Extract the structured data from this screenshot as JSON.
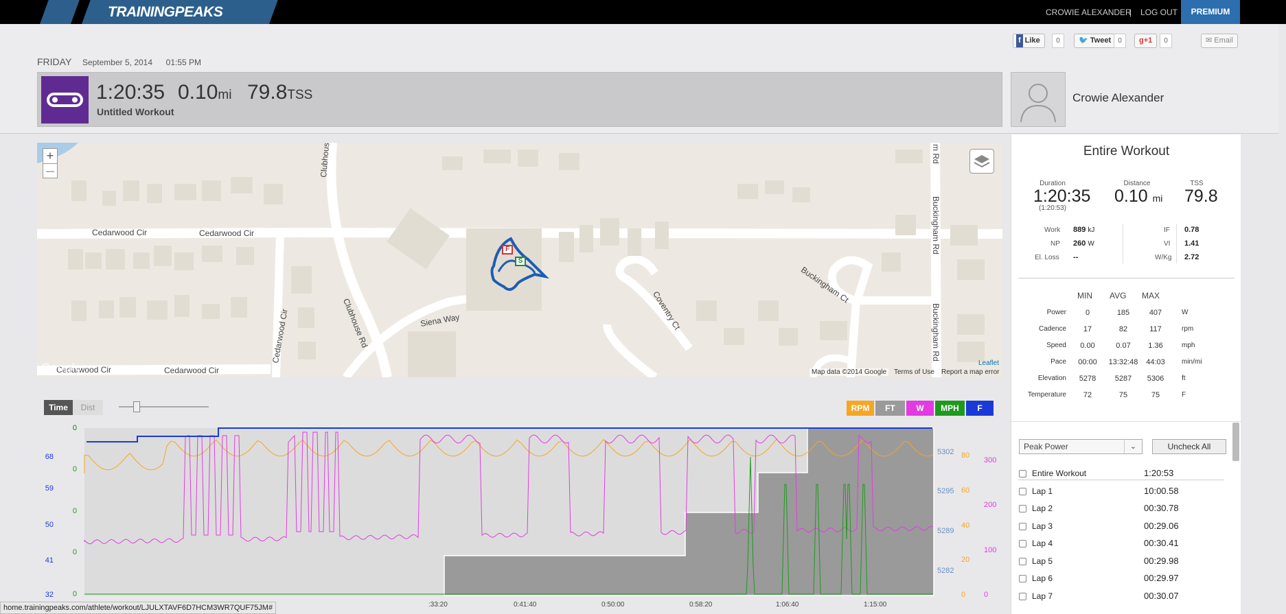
{
  "nav": {
    "brand": "TRAININGPEAKS",
    "user": "CROWIE ALEXANDER",
    "sep": "|",
    "logout": "LOG OUT",
    "premium": "PREMIUM"
  },
  "social": {
    "like": "Like",
    "like_count": "0",
    "tweet": "Tweet",
    "tweet_count": "0",
    "gplus": "+1",
    "gplus_count": "0",
    "email": "Email"
  },
  "workout": {
    "day": "FRIDAY",
    "date": "September 5, 2014",
    "time": "01:55 PM",
    "duration": "1:20:35",
    "distance": "0.10",
    "distance_unit": "mi",
    "tss": "79.8",
    "tss_unit": "TSS",
    "title": "Untitled Workout"
  },
  "athlete": {
    "name": "Crowie Alexander"
  },
  "map": {
    "zoom_in": "+",
    "zoom_out": "—",
    "leaflet": "Leaflet",
    "mapdata": "Map data ©2014 Google",
    "terms": "Terms of Use",
    "report": "Report a map error",
    "google": "Google",
    "roads": [
      "Cedarwood Cir",
      "Cedarwood Cir",
      "Clubhouse",
      "Clubhouse Rd",
      "Siena Way",
      "Cedarwood Cir",
      "Cedarwood Cir",
      "Cedarwood Cir",
      "Coventry Ct",
      "Buckingham Ct",
      "Buckingham Rd",
      "Buckingham Rd",
      "m Rd"
    ],
    "marker_finish": "F",
    "marker_start": "S"
  },
  "summary": {
    "title": "Entire Workout",
    "duration_label": "Duration",
    "duration": "1:20:35",
    "duration_sub": "(1:20:53)",
    "distance_label": "Distance",
    "distance": "0.10",
    "distance_unit": "mi",
    "tss_label": "TSS",
    "tss": "79.8",
    "work_label": "Work",
    "work": "889",
    "work_unit": "kJ",
    "np_label": "NP",
    "np": "260",
    "np_unit": "W",
    "elloss_label": "El. Loss",
    "elloss": "--",
    "if_label": "IF",
    "if": "0.78",
    "vi_label": "VI",
    "vi": "1.41",
    "wkg_label": "W/Kg",
    "wkg": "2.72",
    "headers": [
      "MIN",
      "AVG",
      "MAX"
    ],
    "rows": [
      {
        "label": "Power",
        "min": "0",
        "avg": "185",
        "max": "407",
        "unit": "W"
      },
      {
        "label": "Cadence",
        "min": "17",
        "avg": "82",
        "max": "117",
        "unit": "rpm"
      },
      {
        "label": "Speed",
        "min": "0.00",
        "avg": "0.07",
        "max": "1.36",
        "unit": "mph"
      },
      {
        "label": "Pace",
        "min": "00:00",
        "avg": "13:32:48",
        "max": "44:03",
        "unit": "min/mi"
      },
      {
        "label": "Elevation",
        "min": "5278",
        "avg": "5287",
        "max": "5306",
        "unit": "ft"
      },
      {
        "label": "Temperature",
        "min": "72",
        "avg": "75",
        "max": "75",
        "unit": "F"
      }
    ]
  },
  "laps": {
    "dropdown": "Peak Power",
    "uncheck": "Uncheck All",
    "items": [
      {
        "label": "Entire Workout",
        "time": "1:20:53"
      },
      {
        "label": "Lap 1",
        "time": "10:00.58"
      },
      {
        "label": "Lap 2",
        "time": "00:30.78"
      },
      {
        "label": "Lap 3",
        "time": "00:29.06"
      },
      {
        "label": "Lap 4",
        "time": "00:30.41"
      },
      {
        "label": "Lap 5",
        "time": "00:29.98"
      },
      {
        "label": "Lap 6",
        "time": "00:29.97"
      },
      {
        "label": "Lap 7",
        "time": "00:30.07"
      }
    ]
  },
  "graph": {
    "time_toggle": "Time",
    "dist_toggle": "Dist",
    "chips": [
      {
        "label": "RPM",
        "color": "#f5a623"
      },
      {
        "label": "FT",
        "color": "#9a9a9a"
      },
      {
        "label": "W",
        "color": "#e23be2"
      },
      {
        "label": "MPH",
        "color": "#1e9a1e"
      },
      {
        "label": "F",
        "color": "#1a3ad8"
      }
    ],
    "axis_f": [
      "68",
      "59",
      "50",
      "41",
      "32"
    ],
    "axis_mph": [
      "0",
      "0",
      "0",
      "0",
      "0",
      "0"
    ],
    "axis_ft": [
      "5302",
      "5295",
      "5289",
      "5282"
    ],
    "axis_rpm": [
      "80",
      "60",
      "40",
      "20",
      "0"
    ],
    "axis_w": [
      "300",
      "200",
      "100",
      "0"
    ],
    "xticks": [
      ":33:20",
      "0:41:40",
      "0:50:00",
      "0:58:20",
      "1:06:40",
      "1:15:00"
    ]
  },
  "status_url": "home.trainingpeaks.com/athlete/workout/LJULXTAVF6D7HCM3WR7QUF75JM#"
}
